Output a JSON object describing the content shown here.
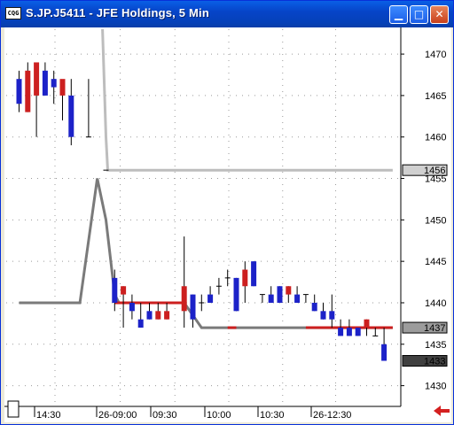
{
  "window": {
    "title": "S.JP.J5411 - JFE Holdings, 5 Min",
    "app_icon_text": "CQG",
    "minimize_icon": "minimize-icon",
    "maximize_icon": "maximize-icon",
    "close_icon": "close-icon"
  },
  "colors": {
    "up": "#cc1f1f",
    "down": "#1c22c8",
    "ma_light": "#bdbdbd",
    "ma_dark": "#7a7a7a",
    "grid": "#9a9a9a"
  },
  "chart_data": {
    "type": "candlestick",
    "title": "S.JP.J5411 - JFE Holdings, 5 Min",
    "ylim": [
      1427.5,
      1473
    ],
    "yticks": [
      1430,
      1435,
      1440,
      1445,
      1450,
      1455,
      1460,
      1465,
      1470
    ],
    "xticks": [
      "14:30",
      "26-09:00",
      "09:30",
      "10:00",
      "10:30",
      "26-12:30"
    ],
    "price_labels": [
      {
        "text": "1456",
        "value": 1456,
        "style": "light"
      },
      {
        "text": "1437",
        "value": 1437,
        "style": "medium"
      },
      {
        "text": "1433",
        "value": 1433,
        "style": "dark"
      }
    ],
    "candles": [
      {
        "i": 0,
        "o": 1467,
        "h": 1468,
        "l": 1463,
        "c": 1464
      },
      {
        "i": 1,
        "o": 1463,
        "h": 1469,
        "l": 1463,
        "c": 1468
      },
      {
        "i": 2,
        "o": 1465,
        "h": 1468,
        "l": 1460,
        "c": 1469
      },
      {
        "i": 3,
        "o": 1468,
        "h": 1469,
        "l": 1465,
        "c": 1465
      },
      {
        "i": 4,
        "o": 1467,
        "h": 1468,
        "l": 1464,
        "c": 1466
      },
      {
        "i": 5,
        "o": 1465,
        "h": 1466,
        "l": 1462,
        "c": 1467
      },
      {
        "i": 6,
        "o": 1465,
        "h": 1467,
        "l": 1459,
        "c": 1460
      },
      {
        "i": 8,
        "o": 1460,
        "h": 1467,
        "l": 1460,
        "c": 1460
      },
      {
        "i": 10,
        "o": 1456,
        "h": 1456,
        "l": 1456,
        "c": 1456
      },
      {
        "i": 11,
        "o": 1443,
        "h": 1444,
        "l": 1439,
        "c": 1440
      },
      {
        "i": 12,
        "o": 1441,
        "h": 1442,
        "l": 1437,
        "c": 1442
      },
      {
        "i": 13,
        "o": 1440,
        "h": 1441,
        "l": 1438,
        "c": 1439
      },
      {
        "i": 14,
        "o": 1438,
        "h": 1440,
        "l": 1437,
        "c": 1437
      },
      {
        "i": 15,
        "o": 1439,
        "h": 1440,
        "l": 1438,
        "c": 1438
      },
      {
        "i": 16,
        "o": 1438,
        "h": 1440,
        "l": 1438,
        "c": 1439
      },
      {
        "i": 17,
        "o": 1438,
        "h": 1440,
        "l": 1438,
        "c": 1439
      },
      {
        "i": 19,
        "o": 1439,
        "h": 1448,
        "l": 1437,
        "c": 1442
      },
      {
        "i": 20,
        "o": 1441,
        "h": 1441,
        "l": 1437,
        "c": 1438
      },
      {
        "i": 21,
        "o": 1440,
        "h": 1441,
        "l": 1439,
        "c": 1440
      },
      {
        "i": 22,
        "o": 1441,
        "h": 1442,
        "l": 1440,
        "c": 1440
      },
      {
        "i": 23,
        "o": 1442,
        "h": 1443,
        "l": 1441,
        "c": 1442
      },
      {
        "i": 24,
        "o": 1443,
        "h": 1444,
        "l": 1442,
        "c": 1443
      },
      {
        "i": 25,
        "o": 1443,
        "h": 1443,
        "l": 1439,
        "c": 1439
      },
      {
        "i": 26,
        "o": 1442,
        "h": 1445,
        "l": 1440,
        "c": 1444
      },
      {
        "i": 27,
        "o": 1445,
        "h": 1445,
        "l": 1442,
        "c": 1442
      },
      {
        "i": 28,
        "o": 1441,
        "h": 1441,
        "l": 1440,
        "c": 1441
      },
      {
        "i": 29,
        "o": 1441,
        "h": 1442,
        "l": 1440,
        "c": 1440
      },
      {
        "i": 30,
        "o": 1442,
        "h": 1442,
        "l": 1440,
        "c": 1440
      },
      {
        "i": 31,
        "o": 1441,
        "h": 1442,
        "l": 1440,
        "c": 1442
      },
      {
        "i": 32,
        "o": 1441,
        "h": 1442,
        "l": 1440,
        "c": 1440
      },
      {
        "i": 33,
        "o": 1441,
        "h": 1441,
        "l": 1440,
        "c": 1441
      },
      {
        "i": 34,
        "o": 1440,
        "h": 1441,
        "l": 1439,
        "c": 1439
      },
      {
        "i": 35,
        "o": 1439,
        "h": 1440,
        "l": 1438,
        "c": 1438
      },
      {
        "i": 36,
        "o": 1439,
        "h": 1441,
        "l": 1437,
        "c": 1438
      },
      {
        "i": 37,
        "o": 1437,
        "h": 1438,
        "l": 1436,
        "c": 1436
      },
      {
        "i": 38,
        "o": 1437,
        "h": 1438,
        "l": 1436,
        "c": 1436
      },
      {
        "i": 39,
        "o": 1437,
        "h": 1437,
        "l": 1436,
        "c": 1436
      },
      {
        "i": 40,
        "o": 1437,
        "h": 1438,
        "l": 1436,
        "c": 1438
      },
      {
        "i": 41,
        "o": 1436,
        "h": 1437,
        "l": 1436,
        "c": 1436
      },
      {
        "i": 42,
        "o": 1435,
        "h": 1437,
        "l": 1433,
        "c": 1433
      }
    ],
    "ma_light": [
      {
        "i": 9.6,
        "v": 1473
      },
      {
        "i": 10,
        "v": 1460
      },
      {
        "i": 10.2,
        "v": 1456
      },
      {
        "i": 43,
        "v": 1456
      }
    ],
    "ma_dark": [
      {
        "i": 0,
        "v": 1440
      },
      {
        "i": 7,
        "v": 1440
      },
      {
        "i": 9,
        "v": 1455
      },
      {
        "i": 10,
        "v": 1450
      },
      {
        "i": 11,
        "v": 1441
      },
      {
        "i": 11.5,
        "v": 1440
      },
      {
        "i": 19,
        "v": 1440
      },
      {
        "i": 21,
        "v": 1437
      },
      {
        "i": 43,
        "v": 1437
      }
    ],
    "ma_red_segments": [
      {
        "from": 11,
        "to": 19,
        "v": 1440
      },
      {
        "from": 24,
        "to": 25,
        "v": 1437
      },
      {
        "from": 33,
        "to": 43,
        "v": 1437
      }
    ]
  }
}
